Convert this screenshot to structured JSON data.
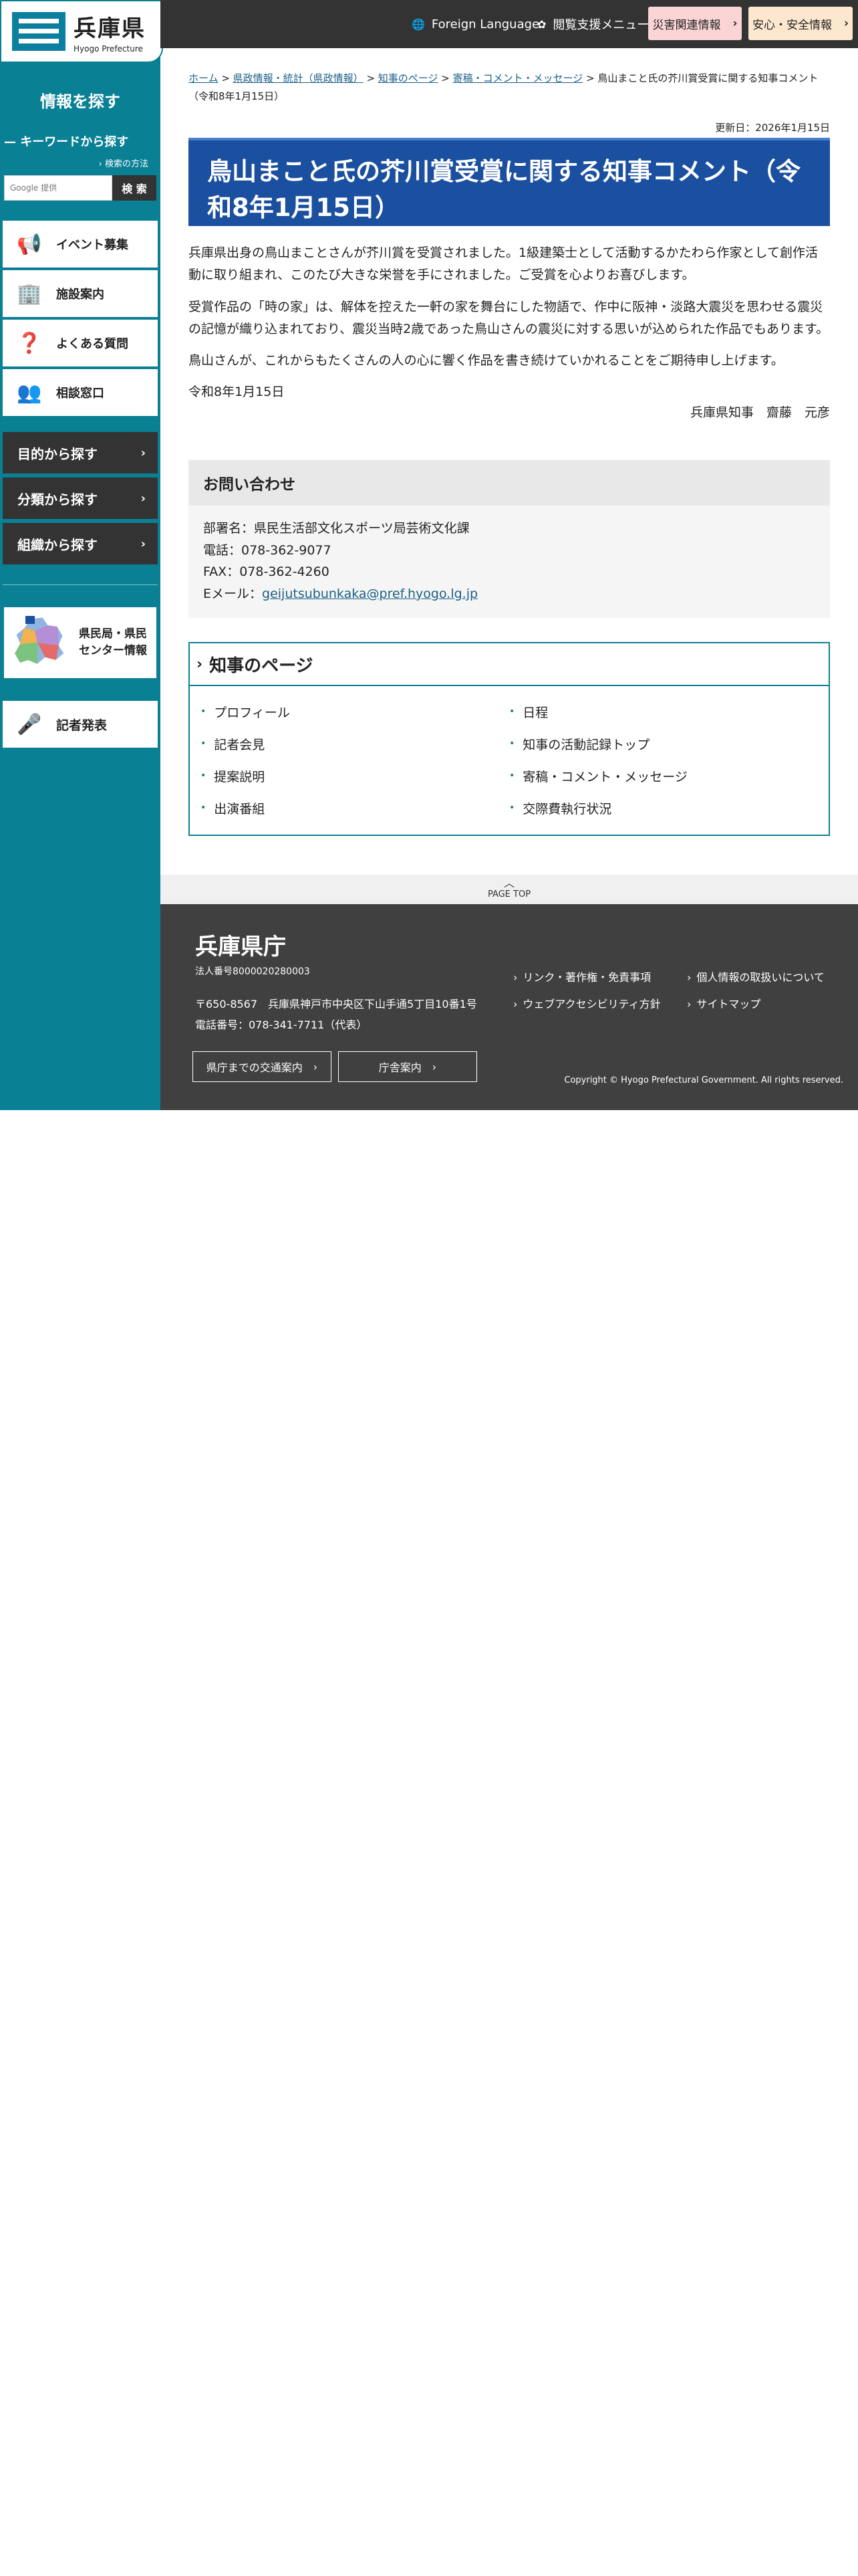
{
  "site": {
    "name_ja": "兵庫県",
    "name_en": "Hyogo Prefecture"
  },
  "sidebar": {
    "find_title": "情報を探す",
    "keyword_title": "キーワードから探す",
    "search_howto": "検索の方法",
    "search_placeholder": "Google 提供",
    "search_button": "検 索",
    "menu": [
      {
        "label": "イベント募集",
        "icon": "megaphone-icon"
      },
      {
        "label": "施設案内",
        "icon": "building-icon"
      },
      {
        "label": "よくある質問",
        "icon": "faq-icon"
      },
      {
        "label": "相談窓口",
        "icon": "consult-icon"
      }
    ],
    "dark_menu": [
      {
        "label": "目的から探す"
      },
      {
        "label": "分類から探す"
      },
      {
        "label": "組織から探す"
      }
    ],
    "center_label_1": "県民局・県民",
    "center_label_2": "センター情報",
    "press_label": "記者発表"
  },
  "topbar": {
    "foreign": "Foreign Language",
    "accessibility": "閲覧支援メニュー",
    "disaster": "災害関連情報",
    "safety": "安心・安全情報",
    "disaster_color": "#fbd5d5",
    "safety_color": "#fde8cf"
  },
  "breadcrumb": {
    "items": [
      "ホーム",
      "県政情報・統計（県政情報）",
      "知事のページ",
      "寄稿・コメント・メッセージ"
    ],
    "current": "鳥山まこと氏の芥川賞受賞に関する知事コメント（令和8年1月15日）"
  },
  "updated": "更新日：2026年1月15日",
  "title": "鳥山まこと氏の芥川賞受賞に関する知事コメント（令和8年1月15日）",
  "body": {
    "p1": "兵庫県出身の鳥山まことさんが芥川賞を受賞されました。1級建築士として活動するかたわら作家として創作活動に取り組まれ、このたび大きな栄誉を手にされました。ご受賞を心よりお喜びします。",
    "p2": "受賞作品の「時の家」は、解体を控えた一軒の家を舞台にした物語で、作中に阪神・淡路大震災を思わせる震災の記憶が織り込まれており、震災当時2歳であった鳥山さんの震災に対する思いが込められた作品でもあります。",
    "p3": "鳥山さんが、これからもたくさんの人の心に響く作品を書き続けていかれることをご期待申し上げます。",
    "date": "令和8年1月15日",
    "signature": "兵庫県知事　齋藤　元彦"
  },
  "inquiry": {
    "heading": "お問い合わせ",
    "dept": "部署名：県民生活部文化スポーツ局芸術文化課",
    "tel": "電話：078-362-9077",
    "fax": "FAX：078-362-4260",
    "email_label": "Eメール：",
    "email": "geijutsubunkaka@pref.hyogo.lg.jp"
  },
  "governor": {
    "heading": "知事のページ",
    "links": [
      "プロフィール",
      "日程",
      "記者会見",
      "知事の活動記録トップ",
      "提案説明",
      "寄稿・コメント・メッセージ",
      "出演番組",
      "交際費執行状況"
    ]
  },
  "pagetop": "PAGE TOP",
  "footer": {
    "name": "兵庫県庁",
    "corp": "法人番号8000020280003",
    "address": "〒650-8567　兵庫県神戸市中央区下山手通5丁目10番1号",
    "phone": "電話番号：078-341-7711（代表）",
    "btn_access": "県庁までの交通案内",
    "btn_building": "庁舎案内",
    "links": [
      "リンク・著作権・免責事項",
      "個人情報の取扱いについて",
      "ウェブアクセシビリティ方針",
      "サイトマップ"
    ],
    "copyright": "Copyright © Hyogo Prefectural Government. All rights reserved."
  }
}
